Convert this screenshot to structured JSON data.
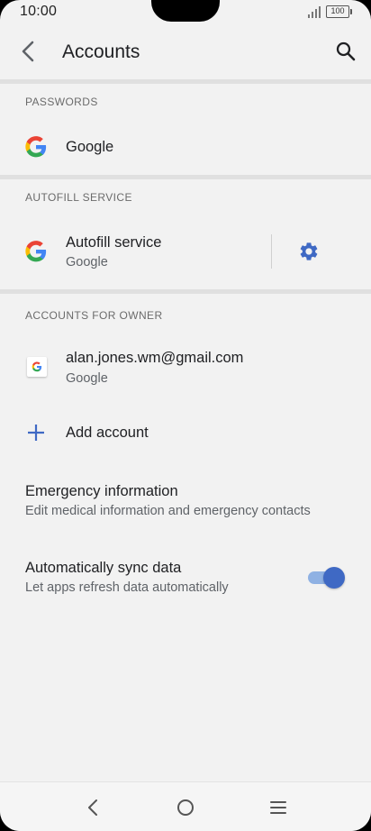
{
  "status_bar": {
    "time": "10:00",
    "battery": "100"
  },
  "app_bar": {
    "title": "Accounts"
  },
  "passwords_section": {
    "header": "PASSWORDS",
    "item": {
      "title": "Google"
    }
  },
  "autofill_section": {
    "header": "AUTOFILL SERVICE",
    "item": {
      "title": "Autofill service",
      "subtitle": "Google"
    }
  },
  "accounts_section": {
    "header": "ACCOUNTS FOR OWNER",
    "account": {
      "title": "alan.jones.wm@gmail.com",
      "subtitle": "Google"
    },
    "add_account": {
      "label": "Add account"
    }
  },
  "emergency": {
    "title": "Emergency information",
    "subtitle": "Edit medical information and emergency contacts"
  },
  "sync": {
    "title": "Automatically sync data",
    "subtitle": "Let apps refresh data automatically",
    "enabled": true
  },
  "colors": {
    "accent": "#3f69c4",
    "background": "#f2f2f2",
    "divider": "#e0e0e0"
  },
  "icons": [
    "back-arrow",
    "search",
    "google-g",
    "gear",
    "plus",
    "nav-back",
    "nav-home",
    "nav-recents"
  ]
}
